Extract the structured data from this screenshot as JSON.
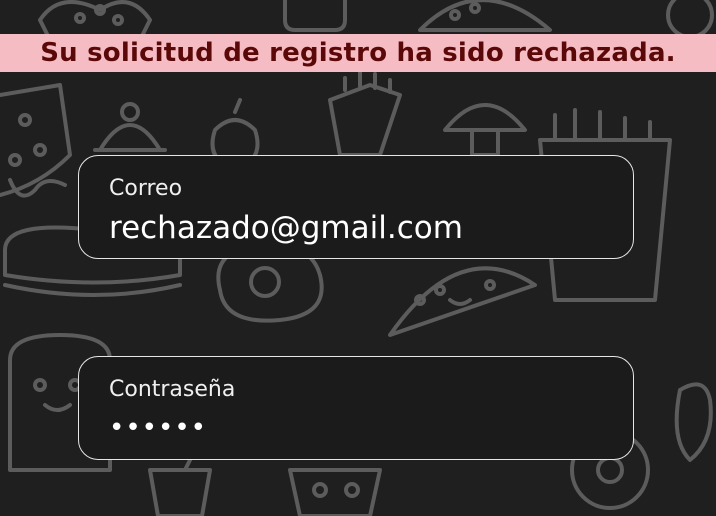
{
  "banner": {
    "message": "Su solicitud de registro ha sido rechazada."
  },
  "form": {
    "email": {
      "label": "Correo",
      "value": "rechazado@gmail.com"
    },
    "password": {
      "label": "Contraseña",
      "value": "••••••"
    }
  },
  "colors": {
    "background": "#1f1f1f",
    "banner_background": "#f6bcc4",
    "banner_text": "#5a0808",
    "field_border": "#e6e6e6",
    "doodle_stroke": "#5c5c5c"
  },
  "background": {
    "pattern": "food-doodle-pattern"
  }
}
